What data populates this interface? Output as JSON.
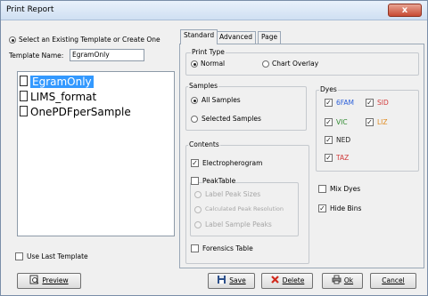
{
  "window": {
    "title": "Print Report",
    "close_glyph": "x"
  },
  "left": {
    "select_existing_label": "Select an Existing Template or Create One",
    "template_name_label": "Template Name:",
    "template_name_value": "EgramOnly",
    "templates": [
      "EgramOnly",
      "LIMS_format",
      "OnePDFperSample"
    ],
    "selected_index": 0,
    "use_last_template_label": "Use Last Template"
  },
  "tabs": [
    "Standard",
    "Advanced",
    "Page"
  ],
  "active_tab": "Standard",
  "print_type": {
    "label": "Print Type",
    "normal": "Normal",
    "chart_overlay": "Chart Overlay"
  },
  "samples": {
    "label": "Samples",
    "all": "All Samples",
    "selected": "Selected Samples"
  },
  "contents": {
    "label": "Contents",
    "electropherogram": "Electropherogram",
    "peak_table": "PeakTable",
    "opt1": "Label Peak Sizes",
    "opt2": "Calculated Peak Resolution",
    "opt3": "Label Sample Peaks",
    "forensics_table": "Forensics Table"
  },
  "dyes": {
    "label": "Dyes",
    "items": [
      {
        "name": "6FAM",
        "color": "#2b5fd9"
      },
      {
        "name": "SID",
        "color": "#d13a3a"
      },
      {
        "name": "VIC",
        "color": "#2f8a2f"
      },
      {
        "name": "LIZ",
        "color": "#e08a1e"
      },
      {
        "name": "NED",
        "color": "#222222"
      },
      {
        "name": "TAZ",
        "color": "#d13a3a"
      }
    ]
  },
  "options": {
    "mix_dyes": "Mix Dyes",
    "hide_bins": "Hide Bins"
  },
  "buttons": {
    "preview": "Preview",
    "save": "Save",
    "delete": "Delete",
    "ok": "Ok",
    "cancel": "Cancel"
  }
}
